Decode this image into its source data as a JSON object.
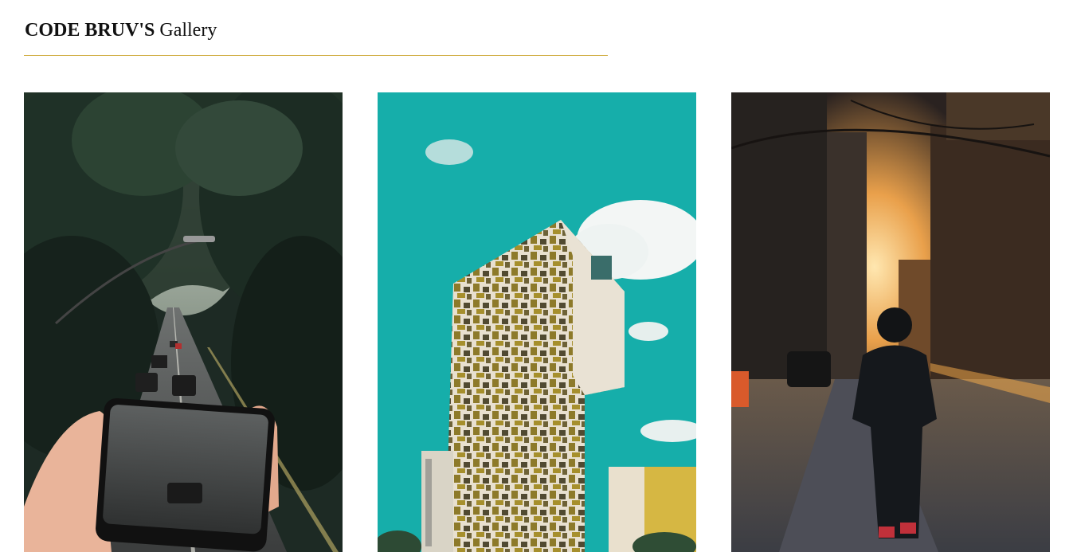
{
  "header": {
    "title_brand": "CODE BRUV'S",
    "title_suffix": "Gallery",
    "underline_color": "#c9a227"
  },
  "gallery": {
    "photos": [
      {
        "subject": "road through forest with hand holding phone",
        "alt": "Road through forest"
      },
      {
        "subject": "colorful tiled tower building against teal sky",
        "alt": "Tower against teal sky"
      },
      {
        "subject": "hooded person walking down city street at sunset",
        "alt": "City street at sunset"
      }
    ]
  }
}
